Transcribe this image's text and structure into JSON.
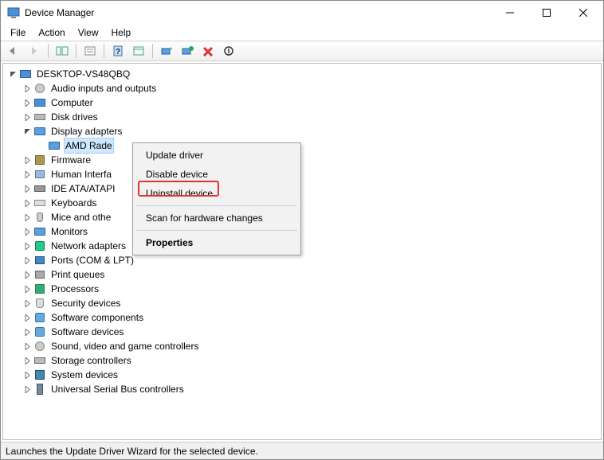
{
  "window": {
    "title": "Device Manager"
  },
  "menu": {
    "file": "File",
    "action": "Action",
    "view": "View",
    "help": "Help"
  },
  "tree": {
    "root": "DESKTOP-VS48QBQ",
    "categories": [
      {
        "label": "Audio inputs and outputs",
        "icon": "sound"
      },
      {
        "label": "Computer",
        "icon": "comp"
      },
      {
        "label": "Disk drives",
        "icon": "drive"
      },
      {
        "label": "Display adapters",
        "icon": "display",
        "expanded": true,
        "children": [
          {
            "label": "AMD Rade",
            "icon": "display",
            "selected": true
          }
        ]
      },
      {
        "label": "Firmware",
        "icon": "fw"
      },
      {
        "label": "Human Interfa",
        "icon": "hid"
      },
      {
        "label": "IDE ATA/ATAPI",
        "icon": "ata"
      },
      {
        "label": "Keyboards",
        "icon": "kb"
      },
      {
        "label": "Mice and othe",
        "icon": "mouse"
      },
      {
        "label": "Monitors",
        "icon": "display"
      },
      {
        "label": "Network adapters",
        "icon": "net"
      },
      {
        "label": "Ports (COM & LPT)",
        "icon": "port"
      },
      {
        "label": "Print queues",
        "icon": "print"
      },
      {
        "label": "Processors",
        "icon": "cpu"
      },
      {
        "label": "Security devices",
        "icon": "sec"
      },
      {
        "label": "Software components",
        "icon": "soft"
      },
      {
        "label": "Software devices",
        "icon": "soft"
      },
      {
        "label": "Sound, video and game controllers",
        "icon": "sound"
      },
      {
        "label": "Storage controllers",
        "icon": "stor"
      },
      {
        "label": "System devices",
        "icon": "sys"
      },
      {
        "label": "Universal Serial Bus controllers",
        "icon": "usb"
      }
    ]
  },
  "context_menu": {
    "update": "Update driver",
    "disable": "Disable device",
    "uninstall": "Uninstall device",
    "scan": "Scan for hardware changes",
    "properties": "Properties"
  },
  "statusbar": {
    "text": "Launches the Update Driver Wizard for the selected device."
  }
}
